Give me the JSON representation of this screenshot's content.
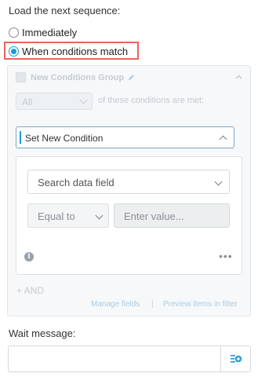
{
  "sequence": {
    "heading": "Load the next sequence:",
    "options": [
      {
        "label": "Immediately",
        "selected": false
      },
      {
        "label": "When conditions match",
        "selected": true
      }
    ]
  },
  "group": {
    "title": "New Conditions Group",
    "match_mode": "All",
    "match_suffix": "of these conditions are met:",
    "set_condition": "Set New Condition",
    "condition": {
      "field_placeholder": "Search data field",
      "operator": "Equal to",
      "value_placeholder": "Enter value..."
    },
    "add_and": "+ AND",
    "manage_fields": "Manage fields",
    "separator": "|",
    "preview_items": "Preview items in filter"
  },
  "wait": {
    "label": "Wait message:",
    "value": ""
  },
  "colors": {
    "accent": "#1a9ad6",
    "highlight_border": "#e8655a",
    "link": "#a8cde3"
  },
  "icons": [
    "radio",
    "pencil-icon",
    "chevron-up-icon",
    "chevron-down-icon",
    "info-icon",
    "more-icon",
    "add-variable-icon"
  ]
}
